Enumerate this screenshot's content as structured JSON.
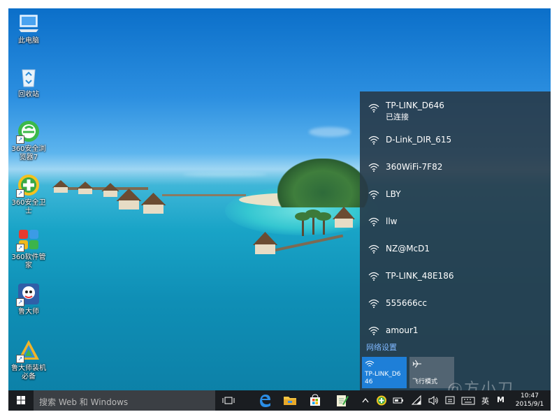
{
  "desktop": {
    "icons": [
      {
        "label": "此电脑",
        "icon": "computer-icon"
      },
      {
        "label": "回收站",
        "icon": "recycle-bin-icon"
      },
      {
        "label": "360安全浏览器7",
        "icon": "360-browser-icon"
      },
      {
        "label": "360安全卫士",
        "icon": "360-security-icon"
      },
      {
        "label": "360软件管家",
        "icon": "360-software-manager-icon"
      },
      {
        "label": "鲁大师",
        "icon": "ludashi-icon"
      },
      {
        "label": "鲁大师装机必备",
        "icon": "ludashi-essentials-icon"
      }
    ]
  },
  "wifi_flyout": {
    "networks": [
      {
        "name": "TP-LINK_D646",
        "status": "已连接"
      },
      {
        "name": "D-Link_DIR_615"
      },
      {
        "name": "360WiFi-7F82"
      },
      {
        "name": "LBY"
      },
      {
        "name": "llw"
      },
      {
        "name": "NZ@McD1"
      },
      {
        "name": "TP-LINK_48E186"
      },
      {
        "name": "555666cc"
      },
      {
        "name": "amour1"
      }
    ],
    "settings_link": "网络设置",
    "quick_actions": [
      {
        "label": "TP-LINK_D646",
        "icon": "wifi-icon",
        "active": true
      },
      {
        "label": "飞行模式",
        "icon": "airplane-icon",
        "active": false
      }
    ]
  },
  "taskbar": {
    "search_placeholder": "搜索 Web 和 Windows",
    "apps": [
      "task-view-icon",
      "edge-icon",
      "file-explorer-icon",
      "store-icon",
      "notepad-icon"
    ],
    "tray": {
      "input_language": "英",
      "ime_mode": "M",
      "time": "10:47",
      "date": "2015/9/1"
    }
  },
  "watermark": "@方小刀",
  "colors": {
    "accent": "#1e7fd8",
    "flyout_bg": "#283a48",
    "taskbar_bg": "#1a1d21",
    "link": "#7fb8ff"
  }
}
